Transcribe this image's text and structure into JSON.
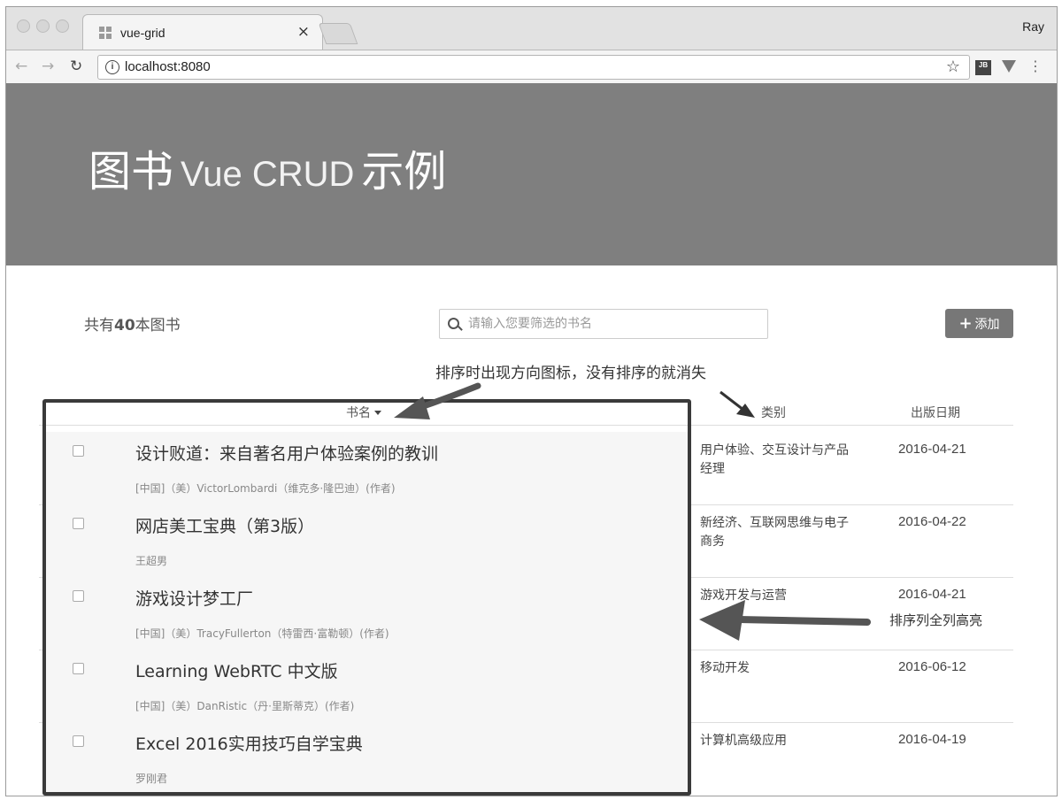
{
  "browser": {
    "tab_title": "vue-grid",
    "tab_close": "×",
    "profile_name": "Ray",
    "url": "localhost:8080",
    "url_info_icon": "i",
    "extension_jb_label": "JB"
  },
  "hero": {
    "title_cn_left": "图书",
    "title_en": "Vue CRUD",
    "title_cn_right": "示例"
  },
  "toolbar": {
    "count_prefix": "共有",
    "count_value": "40",
    "count_suffix": "本图书",
    "search_placeholder": "请输入您要筛选的书名",
    "add_label": "添加"
  },
  "annotations": {
    "sort_icon_note": "排序时出现方向图标，没有排序的就消失",
    "highlight_note": "排序列全列高亮"
  },
  "table": {
    "columns": [
      "书名",
      "类别",
      "出版日期"
    ],
    "sorted_column": "书名",
    "rows": [
      {
        "title": "设计败道：来自著名用户体验案例的教训",
        "author": "[中国]（美）VictorLombardi（维克多·隆巴迪）(作者)",
        "category": "用户体验、交互设计与产品经理",
        "date": "2016-04-21"
      },
      {
        "title": "网店美工宝典（第3版）",
        "author": "王超男",
        "category": "新经济、互联网思维与电子商务",
        "date": "2016-04-22"
      },
      {
        "title": "游戏设计梦工厂",
        "author": "[中国]（美）TracyFullerton（特雷西·富勒顿）(作者)",
        "category": "游戏开发与运营",
        "date": "2016-04-21"
      },
      {
        "title": "Learning WebRTC 中文版",
        "author": "[中国]（美）DanRistic（丹·里斯蒂克）(作者)",
        "category": "移动开发",
        "date": "2016-06-12"
      },
      {
        "title": "Excel 2016实用技巧自学宝典",
        "author": "罗刚君",
        "category": "计算机高级应用",
        "date": "2016-04-19"
      }
    ]
  },
  "colors": {
    "hero_bg": "#7f7f7f",
    "add_button_bg": "#777777",
    "annotation_dark": "#3a3a3a",
    "annotation_arrow": "#555555"
  },
  "icons": [
    "window-close-dot",
    "window-minimize-dot",
    "window-zoom-dot",
    "favicon-grid-icon",
    "back-arrow-icon",
    "forward-arrow-icon",
    "reload-icon",
    "info-icon",
    "bookmark-star-icon",
    "jetbrains-extension-icon",
    "vue-devtools-icon",
    "menu-dots-icon",
    "search-icon",
    "plus-icon",
    "checkbox-icon",
    "sort-caret-down-icon",
    "annotation-arrow-icon"
  ]
}
